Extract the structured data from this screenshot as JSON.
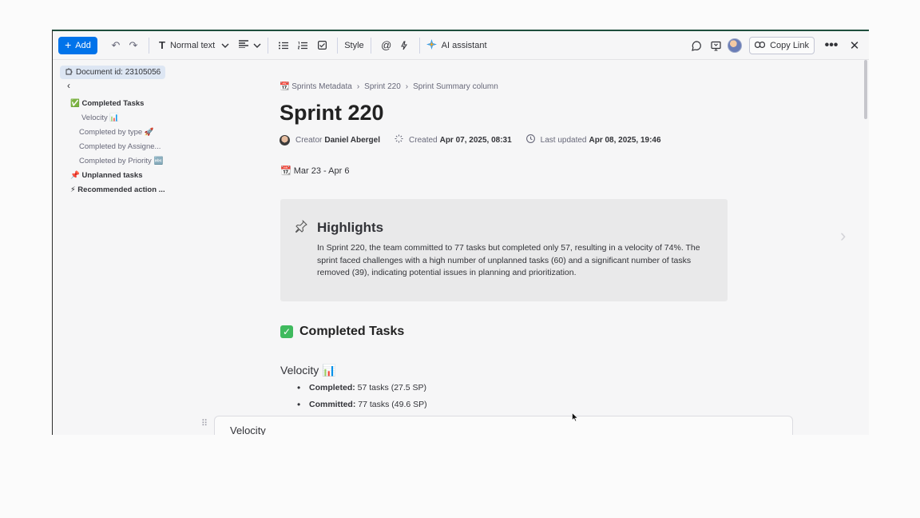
{
  "toolbar": {
    "add_label": "Add",
    "text_style": "Normal text",
    "style_label": "Style",
    "ai_label": "AI assistant",
    "copy_link_label": "Copy Link",
    "ai_color": "#0073ea"
  },
  "sidebar": {
    "document_id": "Document id: 23105056",
    "toc": [
      {
        "label": "✅ Completed Tasks"
      },
      {
        "label": "Velocity 📊"
      },
      {
        "label": "Completed by type 🚀"
      },
      {
        "label": "Completed by Assigne..."
      },
      {
        "label": "Completed by Priority 🔤"
      },
      {
        "label": "📌 Unplanned tasks"
      },
      {
        "label": "⚡ Recommended action ..."
      }
    ]
  },
  "breadcrumb": [
    "📆 Sprints Metadata",
    "Sprint 220",
    "Sprint Summary column"
  ],
  "doc": {
    "title": "Sprint 220",
    "creator_label": "Creator",
    "creator_name": "Daniel Abergel",
    "created_label": "Created",
    "created_value": "Apr 07, 2025, 08:31",
    "updated_label": "Last updated",
    "updated_value": "Apr 08, 2025, 19:46",
    "date_range": "📆 Mar 23 - Apr 6"
  },
  "highlights": {
    "title": "Highlights",
    "body": "In Sprint 220, the team committed to 77 tasks but completed only 57, resulting in a velocity of 74%. The sprint faced challenges with a high number of unplanned tasks (60) and a significant number of tasks removed (39), indicating potential issues in planning and prioritization."
  },
  "completed": {
    "heading": "Completed Tasks",
    "velocity_heading": "Velocity 📊",
    "bullets": [
      {
        "label": "Completed:",
        "value": "57 tasks (27.5 SP)"
      },
      {
        "label": "Committed:",
        "value": "77 tasks (49.6 SP)"
      }
    ]
  },
  "card": {
    "title": "Velocity"
  }
}
